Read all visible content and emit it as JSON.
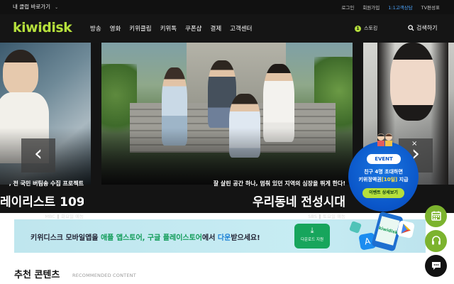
{
  "topbar": {
    "my_club": "내 클럽 바로가기",
    "links": [
      "로그인",
      "회원가입",
      "1:1고객상담",
      "TV편성표"
    ]
  },
  "nav": {
    "logo": "kiwidisk",
    "menu": [
      "방송",
      "영화",
      "키위클립",
      "키위톡",
      "쿠폰샵",
      "결제",
      "고객센터"
    ],
    "notice_count": "1",
    "notice_label": "스토킹",
    "search_label": "검색하기"
  },
  "hero": {
    "left": {
      "subtitle": ", 전 국민 버팀송 수집 프로젝트",
      "title": "레이리스트 109",
      "channel": "MBC",
      "airtime": "화요일 예능"
    },
    "main": {
      "subtitle": "잘 살린 공간 하나, 멈춰 있던 지역의 심장을 뛰게 한다!",
      "title": "우리동네 전성시대",
      "channel": "SBS",
      "airtime": "토요일 예능"
    },
    "arrow_prev": "‹",
    "arrow_next": "›",
    "dots_total": 7,
    "dots_active_index": 0
  },
  "event": {
    "badge": "EVENT",
    "line1": "친구 4명 초대하면",
    "line2_prefix": "키위정액권",
    "line2_highlight": "[10일]",
    "line2_suffix": "지급",
    "button": "이벤트 상세보기",
    "close": "×"
  },
  "banner": {
    "part1": "키위디스크 모바일앱을 ",
    "part2": "애플 앱스토어, 구글 플레이스토어",
    "part3": "에서 ",
    "part4": "다운",
    "part5": "받으세요!",
    "download_label": "다운로드 지원",
    "phone_label": "kiwidisk"
  },
  "recommended": {
    "title": "추천 콘텐츠",
    "subtitle": "RECOMMENDED CONTENT"
  },
  "floating": [
    "calendar-icon",
    "headset-icon",
    "chat-icon"
  ],
  "colors": {
    "accent_green": "#b5df3c",
    "dot_active": "#8cc63f",
    "event_blue": "#0a55c8",
    "banner_bg": "#c7ecf3"
  }
}
